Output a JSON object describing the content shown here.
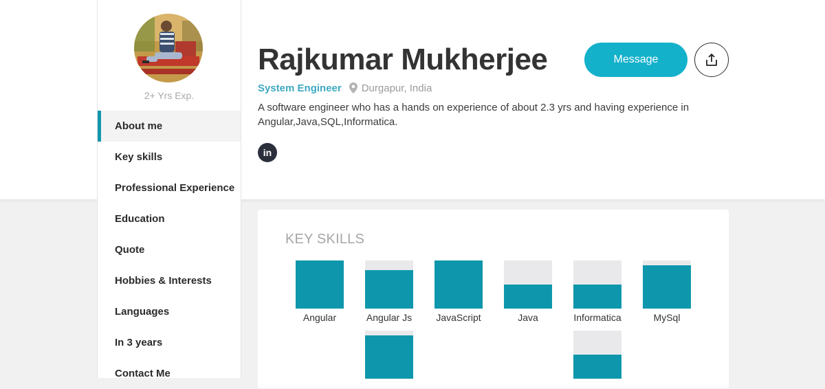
{
  "profile": {
    "experience": "2+ Yrs Exp.",
    "name": "Rajkumar Mukherjee",
    "role": "System Engineer",
    "location": "Durgapur, India",
    "bio": "A software engineer who has a hands on experience of about 2.3 yrs and having experience in Angular,Java,SQL,Informatica.",
    "linkedin_glyph": "in"
  },
  "actions": {
    "message_label": "Message",
    "share_icon": "share-upload-icon"
  },
  "nav": {
    "active_index": 0,
    "items": [
      {
        "label": "About me"
      },
      {
        "label": "Key skills"
      },
      {
        "label": "Professional Experience"
      },
      {
        "label": "Education"
      },
      {
        "label": "Quote"
      },
      {
        "label": "Hobbies & Interests"
      },
      {
        "label": "Languages"
      },
      {
        "label": "In 3 years"
      },
      {
        "label": "Contact Me"
      }
    ]
  },
  "key_skills": {
    "title": "KEY SKILLS",
    "accent_color": "#0e97ac",
    "track_color": "#e9e9ec",
    "skills": [
      {
        "label": "Angular",
        "level": 100
      },
      {
        "label": "Angular Js",
        "level": 80
      },
      {
        "label": "JavaScript",
        "level": 100
      },
      {
        "label": "Java",
        "level": 50
      },
      {
        "label": "Informatica",
        "level": 50
      },
      {
        "label": "MySql",
        "level": 90
      },
      {
        "label": "",
        "level": 90
      },
      {
        "label": "",
        "level": 50
      }
    ]
  },
  "colors": {
    "accent": "#14b1cb",
    "role_text": "#3ea9c4",
    "active_nav_marker": "#1297ad"
  }
}
